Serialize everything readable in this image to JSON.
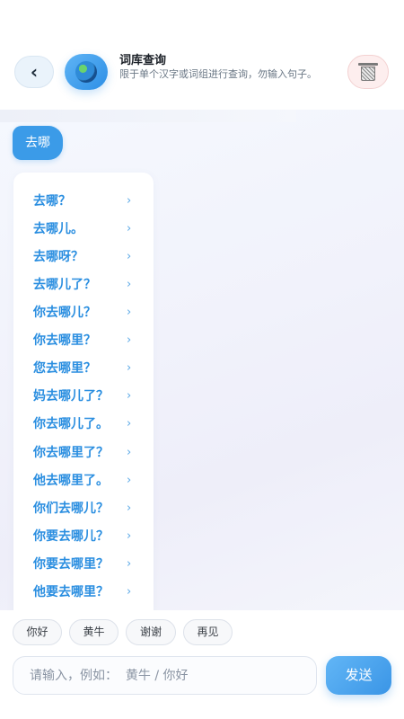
{
  "header": {
    "back_icon": "chevron-left-icon",
    "app_icon": "globe-icon",
    "title": "词库查询",
    "subtitle": "限于单个汉字或词组进行查询，勿输入句子。",
    "trash_icon": "trash-icon"
  },
  "chat": {
    "user_message": "去哪",
    "results": [
      "去哪？",
      "去哪儿。",
      "去哪呀？",
      "去哪儿了？",
      "你去哪儿？",
      "你去哪里？",
      "您去哪里？",
      "妈去哪儿了？",
      "你去哪儿了。",
      "你去哪里了？",
      "他去哪里了。",
      "你们去哪儿？",
      "你要去哪儿？",
      "你要去哪里？",
      "他要去哪里？"
    ],
    "chevron": "›"
  },
  "footer": {
    "chips": [
      "你好",
      "黄牛",
      "谢谢",
      "再见"
    ],
    "input_placeholder": "请输入，例如：  黄牛 / 你好",
    "send_label": "发送"
  },
  "colors": {
    "accent": "#3b9be8",
    "result_text": "#2a8ee0"
  }
}
